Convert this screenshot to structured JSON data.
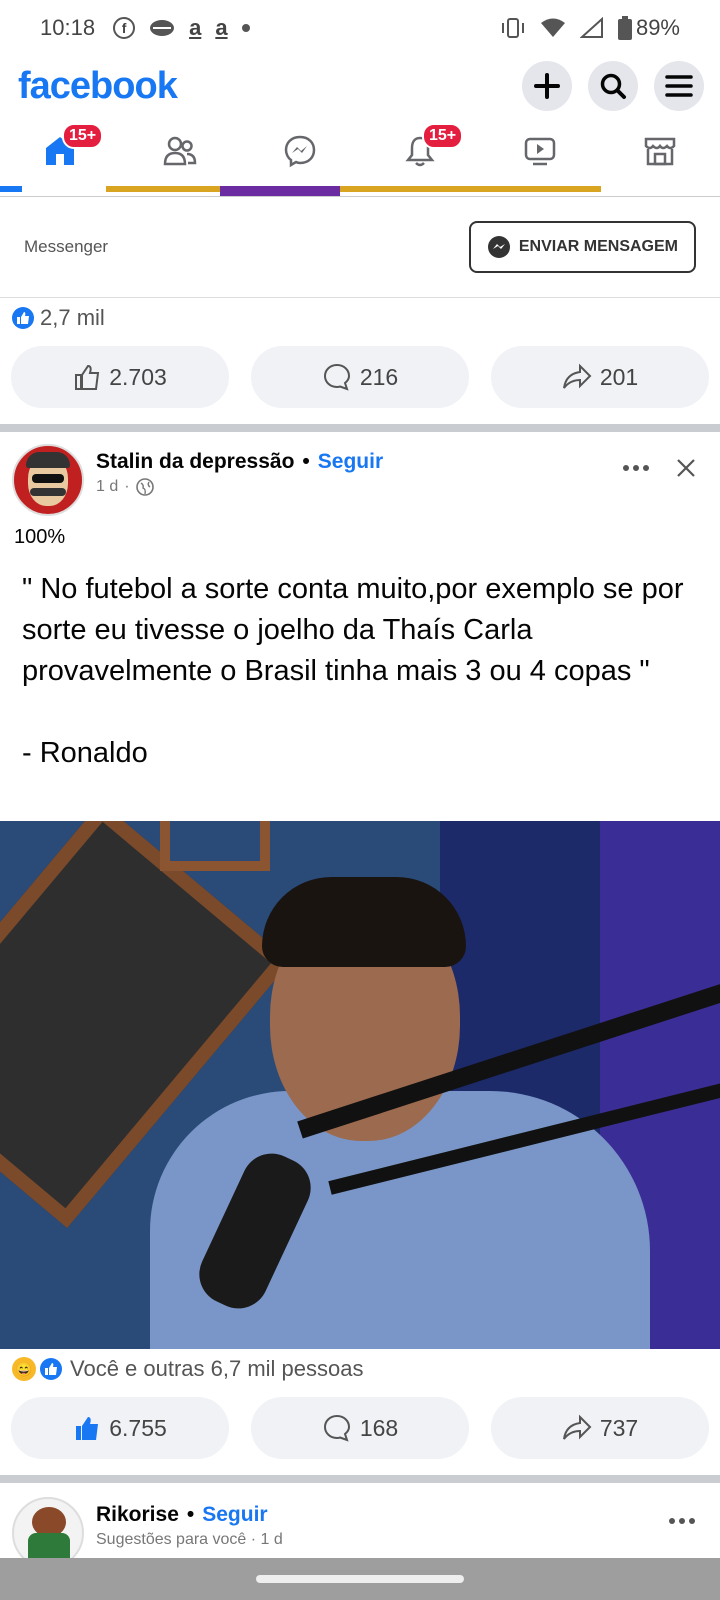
{
  "status": {
    "time": "10:18",
    "battery": "89%"
  },
  "header": {
    "logo": "facebook"
  },
  "nav": {
    "home_badge": "15+",
    "notif_badge": "15+"
  },
  "messenger_row": {
    "label": "Messenger",
    "button": "ENVIAR MENSAGEM"
  },
  "prev_post": {
    "reaction_count": "2,7 mil",
    "likes": "2.703",
    "comments": "216",
    "shares": "201"
  },
  "post": {
    "author": "Stalin da depressão",
    "follow": "Seguir",
    "dot": "•",
    "time": "1 d",
    "percent": "100%",
    "text": "\" No futebol a sorte conta muito,por exemplo se por sorte eu tivesse o joelho da Thaís Carla provavelmente o Brasil tinha mais 3 ou 4 copas \"\n\n- Ronaldo",
    "reactions_text": "Você e outras 6,7 mil pessoas",
    "likes": "6.755",
    "comments": "168",
    "shares": "737"
  },
  "next_post": {
    "author": "Rikorise",
    "follow": "Seguir",
    "meta": "Sugestões para você · 1 d"
  },
  "colors": {
    "brand": "#1877f2",
    "badge": "#e41e3f"
  }
}
